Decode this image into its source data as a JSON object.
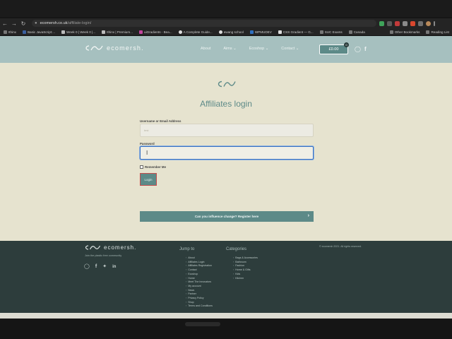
{
  "browser": {
    "url_host": "ecomersh.co.uk",
    "url_path": "/affiliate-login/",
    "bookmarks": [
      "Ithinx",
      "Basic JavaScript:...",
      "Week 0 | Week 0 |...",
      "Ithinx | Premium...",
      "uiGradients - Bea...",
      "A Complete Guide...",
      "ewang school",
      "WPMUDEV",
      "CSS Gradient — G...",
      "SUC Exams",
      "Canada"
    ],
    "bookmarks_right": [
      "Other Bookmarks",
      "Reading List"
    ]
  },
  "header": {
    "brand": "ecomersh.",
    "nav": [
      "About",
      "Aims",
      "Ecoshop",
      "Contact"
    ],
    "cart_total": "£0.00",
    "cart_count": "0"
  },
  "login": {
    "title": "Affiliates login",
    "username_label": "Username or Email Address",
    "username_value": "test",
    "password_label": "Password",
    "remember_label": "Remember Me",
    "login_button": "Login",
    "register_text": "Can you influence change? Register here"
  },
  "footer": {
    "brand": "ecomersh.",
    "tagline": "Join the plastic free community",
    "jump_heading": "Jump to",
    "jump_links": [
      "About",
      "Affiliates Login",
      "Affiliates Registration",
      "Contact",
      "Ecoshop",
      "Home",
      "Meet The Innovators",
      "My account",
      "News",
      "Partner",
      "Privacy Policy",
      "Shop",
      "Terms and Conditions"
    ],
    "categories_heading": "Categories",
    "categories": [
      "Bags & Accessories",
      "Bathroom",
      "Fashion",
      "Home & Gifts",
      "Kids",
      "Kitchen"
    ],
    "copyright": "© ecomersh 2021. All rights reserved."
  },
  "colors": {
    "header_bg": "#a6c0bf",
    "accent": "#5d8a88",
    "page_bg": "#e6e3cf",
    "footer_bg": "#2d3d3c"
  }
}
